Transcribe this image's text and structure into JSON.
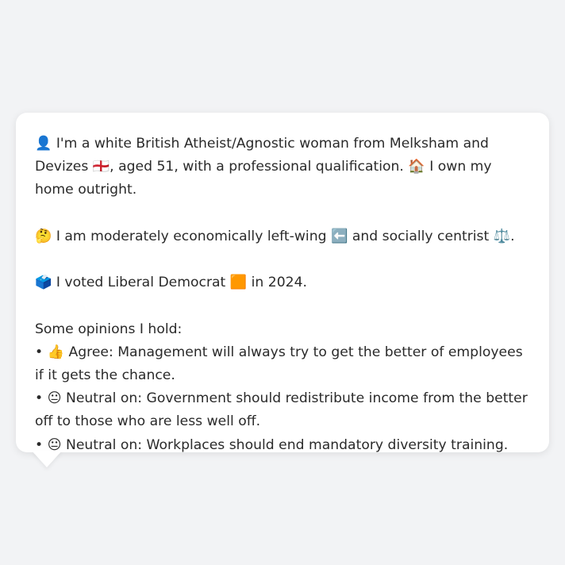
{
  "message": {
    "intro": "👤 I'm a white British Atheist/Agnostic woman from Melksham and Devizes 🏴󠁧󠁢󠁥󠁮󠁧󠁿, aged 51, with a professional qualification. 🏠 I own my home outright.",
    "politics": "🤔 I am moderately economically left-wing ⬅️ and socially centrist ⚖️.",
    "vote": "🗳️ I voted Liberal Democrat 🟧 in 2024.",
    "opinions_heading": "Some opinions I hold:",
    "opinions": [
      "• 👍 Agree: Management will always try to get the better of employees if it gets the chance.",
      "• 😐 Neutral on: Government should redistribute income from the better off to those who are less well off.",
      "• 😐 Neutral on: Workplaces should end mandatory diversity training."
    ]
  },
  "colors": {
    "page_background": "#f2f3f5",
    "bubble_background": "#ffffff",
    "text": "#2a2a2a"
  }
}
